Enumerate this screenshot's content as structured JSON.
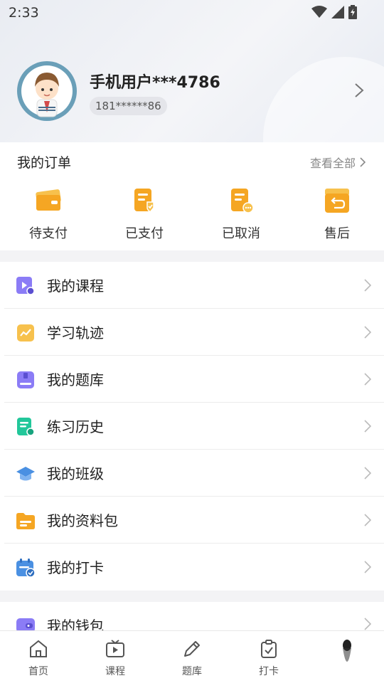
{
  "status_bar": {
    "time": "2:33"
  },
  "profile": {
    "username": "手机用户***4786",
    "phone": "181******86"
  },
  "orders": {
    "title": "我的订单",
    "view_all": "查看全部",
    "items": [
      {
        "label": "待支付",
        "icon": "pending-payment-icon"
      },
      {
        "label": "已支付",
        "icon": "paid-icon"
      },
      {
        "label": "已取消",
        "icon": "cancelled-icon"
      },
      {
        "label": "售后",
        "icon": "after-sales-icon"
      }
    ]
  },
  "menu": {
    "items": [
      {
        "label": "我的课程",
        "icon": "course-icon"
      },
      {
        "label": "学习轨迹",
        "icon": "learning-track-icon"
      },
      {
        "label": "我的题库",
        "icon": "question-bank-icon"
      },
      {
        "label": "练习历史",
        "icon": "practice-history-icon"
      },
      {
        "label": "我的班级",
        "icon": "class-icon"
      },
      {
        "label": "我的资料包",
        "icon": "materials-icon"
      },
      {
        "label": "我的打卡",
        "icon": "checkin-icon"
      }
    ],
    "wallet": {
      "label": "我的钱包",
      "icon": "wallet-icon"
    }
  },
  "tabbar": {
    "items": [
      {
        "label": "首页",
        "icon": "home-icon"
      },
      {
        "label": "课程",
        "icon": "course-tab-icon"
      },
      {
        "label": "题库",
        "icon": "question-bank-tab-icon"
      },
      {
        "label": "打卡",
        "icon": "checkin-tab-icon"
      }
    ]
  },
  "colors": {
    "accent_orange": "#f5a623",
    "purple": "#8b7cf6",
    "green": "#22c79a",
    "blue": "#4a90e2"
  }
}
